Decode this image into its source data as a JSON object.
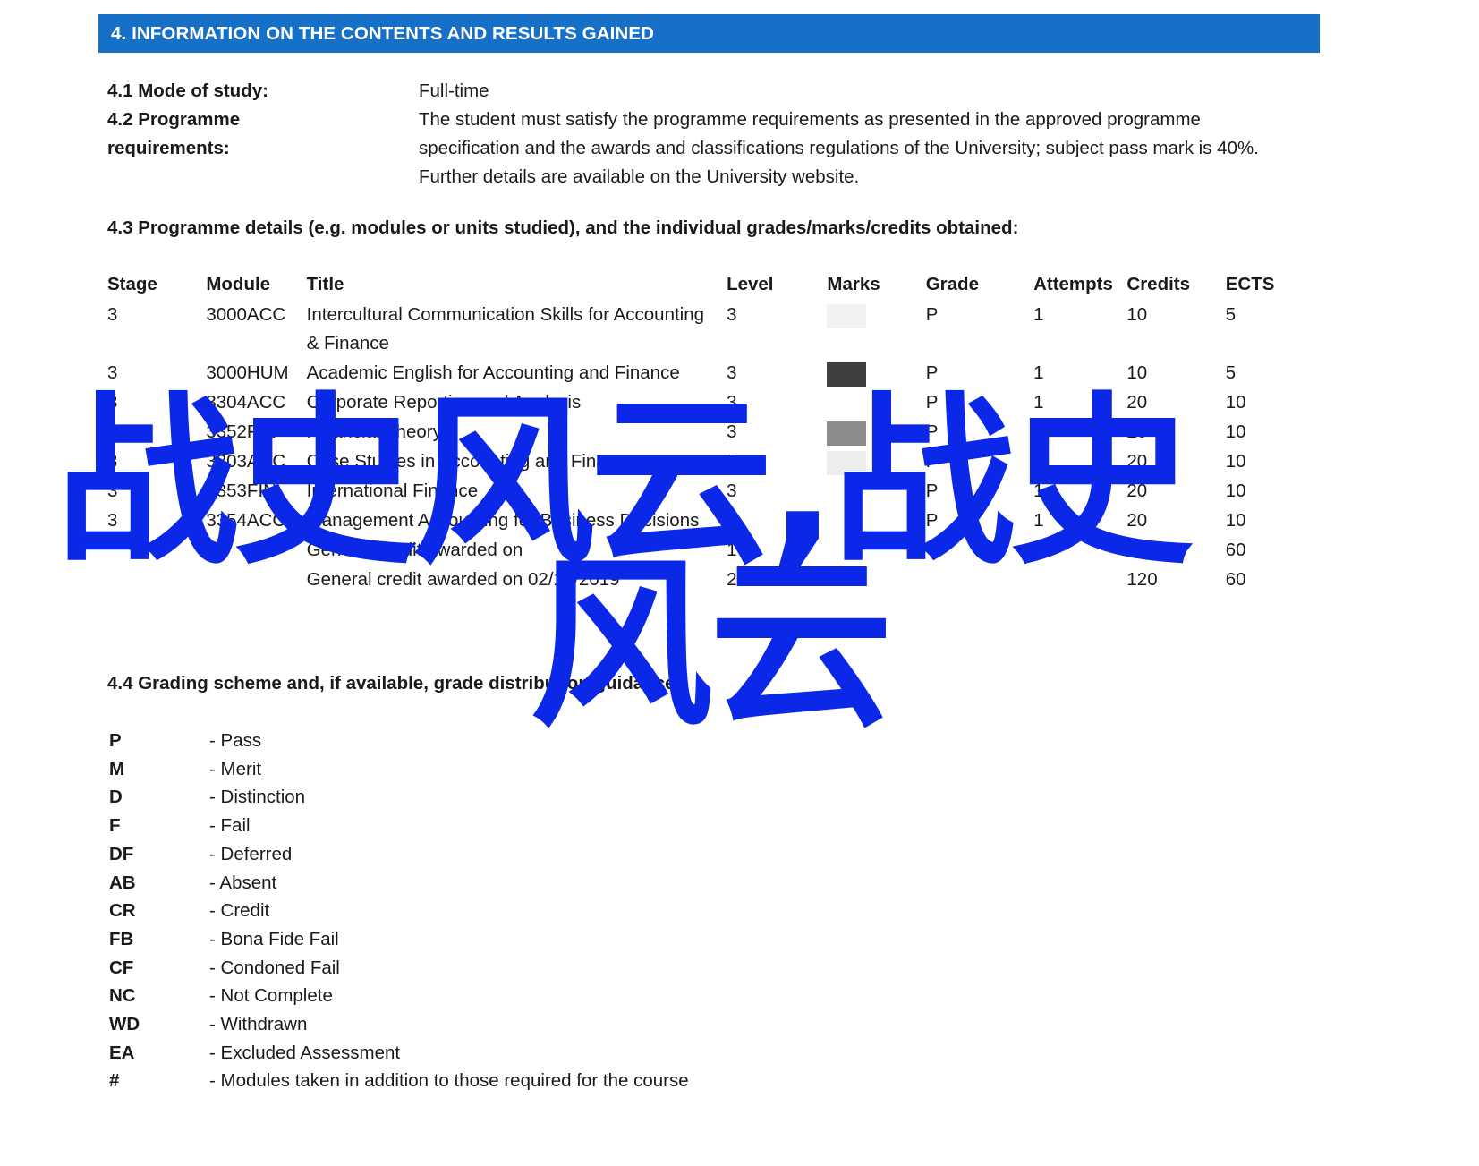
{
  "section": {
    "bar_title": "4. INFORMATION ON THE CONTENTS AND RESULTS GAINED",
    "bar_color": "#1670c8"
  },
  "fields": {
    "mode_of_study_label": "4.1 Mode of study:",
    "mode_of_study_value": "Full-time",
    "programme_requirements_label_line1": "4.2 Programme",
    "programme_requirements_label_line2": "requirements:",
    "programme_requirements_value": "The student must satisfy the programme requirements as presented in the approved programme specification and the awards and classifications regulations of the University; subject pass mark is 40%. Further details are available on the University website."
  },
  "programme_details": {
    "heading": "4.3 Programme details (e.g. modules or units studied), and the individual grades/marks/credits obtained:",
    "columns": [
      "Stage",
      "Module",
      "Title",
      "Level",
      "Marks",
      "Grade",
      "Attempts",
      "Credits",
      "ECTS"
    ],
    "rows": [
      {
        "stage": "3",
        "module": "3000ACC",
        "title": "Intercultural Communication Skills for Accounting & Finance",
        "level": "3",
        "marks": "",
        "marks_redaction_color": "#f2f2f2",
        "grade": "P",
        "attempts": "1",
        "credits": "10",
        "ects": "5"
      },
      {
        "stage": "3",
        "module": "3000HUM",
        "title": "Academic English for Accounting and Finance",
        "level": "3",
        "marks": "",
        "marks_redaction_color": "#3f3f3f",
        "grade": "P",
        "attempts": "1",
        "credits": "10",
        "ects": "5"
      },
      {
        "stage": "3",
        "module": "3304ACC",
        "title": "Corporate Reporting and Analysis",
        "level": "3",
        "marks": "",
        "marks_redaction_color": "#ffffff",
        "grade": "P",
        "attempts": "1",
        "credits": "20",
        "ects": "10"
      },
      {
        "stage": "3",
        "module": "3352FIN",
        "title": "Financial Theory",
        "level": "3",
        "marks": "",
        "marks_redaction_color": "#8c8c8c",
        "grade": "P",
        "attempts": "1",
        "credits": "20",
        "ects": "10"
      },
      {
        "stage": "3",
        "module": "3303ACC",
        "title": "Case Studies in Accounting and Finance",
        "level": "3",
        "marks": "",
        "marks_redaction_color": "#ededed",
        "grade": "P",
        "attempts": "1",
        "credits": "20",
        "ects": "10"
      },
      {
        "stage": "3",
        "module": "3353FIN",
        "title": "International Finance",
        "level": "3",
        "marks": "",
        "marks_redaction_color": "#ffffff",
        "grade": "P",
        "attempts": "1",
        "credits": "20",
        "ects": "10"
      },
      {
        "stage": "3",
        "module": "3354ACC",
        "title": "Management Accounting for Business Decisions",
        "level": "3",
        "marks": "",
        "marks_redaction_color": "#ffffff",
        "grade": "P",
        "attempts": "1",
        "credits": "20",
        "ects": "10"
      },
      {
        "stage": "",
        "module": "",
        "title": "General credit awarded on",
        "level": "1",
        "marks": "",
        "marks_redaction_color": "#ffffff",
        "grade": "",
        "attempts": "",
        "credits": "120",
        "ects": "60"
      },
      {
        "stage": "",
        "module": "",
        "title": "General credit awarded on 02/12/2019",
        "level": "2",
        "marks": "",
        "marks_redaction_color": "#ffffff",
        "grade": "",
        "attempts": "",
        "credits": "120",
        "ects": "60"
      }
    ]
  },
  "grading_scheme": {
    "heading": "4.4 Grading scheme and, if available, grade distribution guidance",
    "entries": [
      {
        "code": "P",
        "description": "- Pass"
      },
      {
        "code": "M",
        "description": "- Merit"
      },
      {
        "code": "D",
        "description": "- Distinction"
      },
      {
        "code": "F",
        "description": "- Fail"
      },
      {
        "code": "DF",
        "description": "- Deferred"
      },
      {
        "code": "AB",
        "description": "- Absent"
      },
      {
        "code": "CR",
        "description": "- Credit"
      },
      {
        "code": "FB",
        "description": "- Bona Fide Fail"
      },
      {
        "code": "CF",
        "description": "- Condoned Fail"
      },
      {
        "code": "NC",
        "description": "- Not Complete"
      },
      {
        "code": "WD",
        "description": "- Withdrawn"
      },
      {
        "code": "EA",
        "description": "- Excluded Assessment"
      },
      {
        "code": "#",
        "description": "- Modules taken in addition to those required for the course"
      }
    ]
  },
  "watermark": {
    "line1": "战史风云,战史",
    "line2": "风云",
    "color": "#0b27e8"
  }
}
